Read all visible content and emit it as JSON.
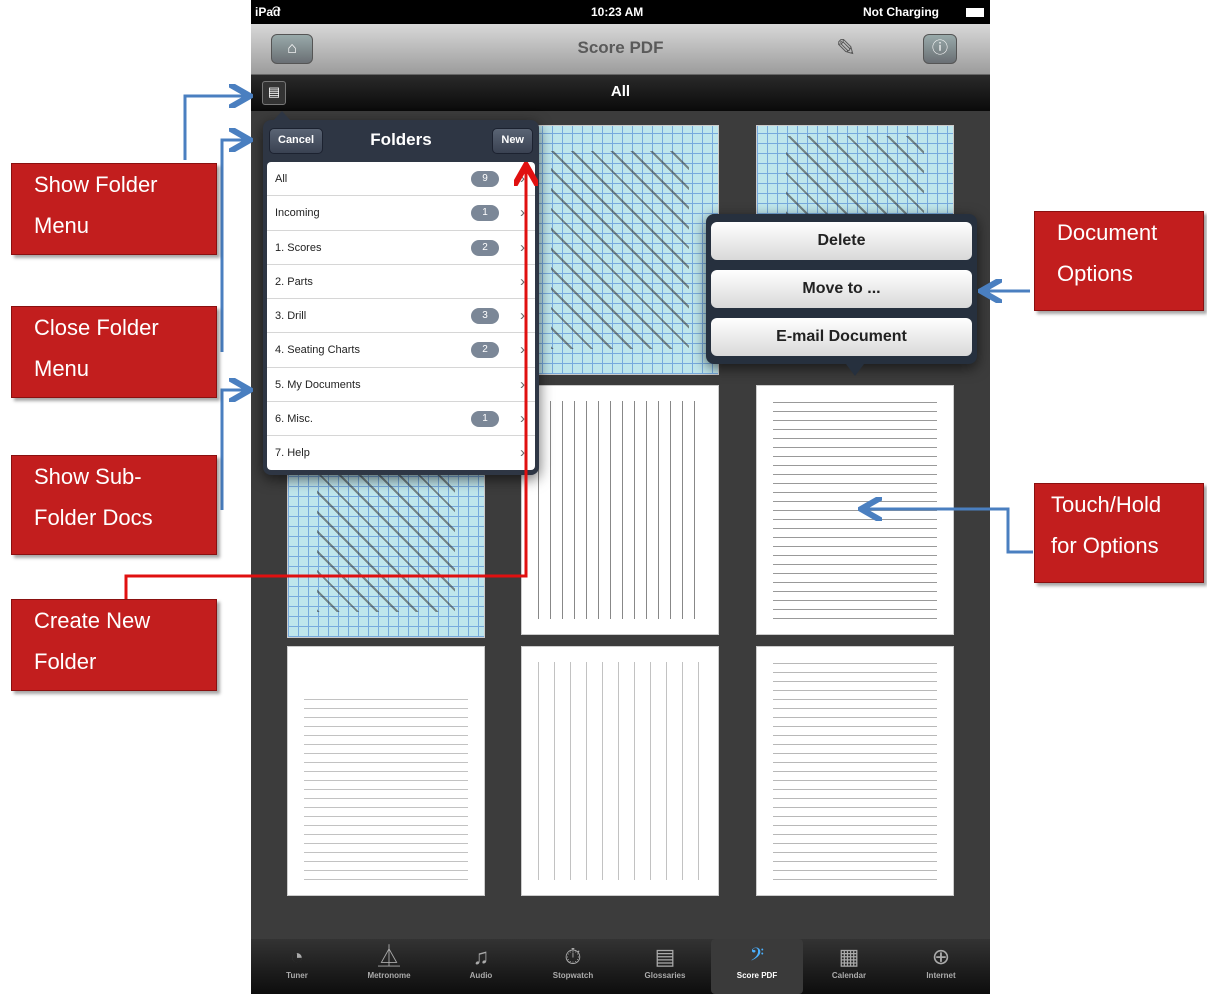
{
  "status": {
    "carrier": "iPad",
    "time": "10:23 AM",
    "battery": "Not Charging"
  },
  "nav": {
    "title": "Score PDF",
    "home_icon": "home-icon",
    "edit_icon": "pencil-icon",
    "info_icon": "info-icon"
  },
  "filter": {
    "title": "All",
    "folder_icon": "folder-icon"
  },
  "folders": {
    "title": "Folders",
    "cancel": "Cancel",
    "new": "New",
    "items": [
      {
        "label": "All",
        "count": "9"
      },
      {
        "label": "Incoming",
        "count": "1"
      },
      {
        "label": "1. Scores",
        "count": "2"
      },
      {
        "label": "2. Parts",
        "count": ""
      },
      {
        "label": "3. Drill",
        "count": "3"
      },
      {
        "label": "4. Seating Charts",
        "count": "2"
      },
      {
        "label": "5. My Documents",
        "count": ""
      },
      {
        "label": "6. Misc.",
        "count": "1"
      },
      {
        "label": "7. Help",
        "count": ""
      }
    ]
  },
  "doc_options": {
    "delete": "Delete",
    "move": "Move to ...",
    "email": "E-mail Document"
  },
  "tabs": [
    {
      "label": "Tuner",
      "icon": "tuner-icon"
    },
    {
      "label": "Metronome",
      "icon": "metronome-icon"
    },
    {
      "label": "Audio",
      "icon": "music-note-icon"
    },
    {
      "label": "Stopwatch",
      "icon": "stopwatch-icon"
    },
    {
      "label": "Glossaries",
      "icon": "glossary-icon"
    },
    {
      "label": "Score PDF",
      "icon": "bass-clef-icon"
    },
    {
      "label": "Calendar",
      "icon": "calendar-icon"
    },
    {
      "label": "Internet",
      "icon": "globe-icon"
    }
  ],
  "callouts": {
    "show_folder_1": "Show Folder",
    "show_folder_2": "Menu",
    "close_folder_1": "Close Folder",
    "close_folder_2": "Menu",
    "show_sub_1": "Show Sub-",
    "show_sub_2": "Folder Docs",
    "create_1": "Create New",
    "create_2": "Folder",
    "doc_opts_1": "Document",
    "doc_opts_2": "Options",
    "touch_1": "Touch/Hold",
    "touch_2": "for Options"
  },
  "colors": {
    "callout": "#c21e1e",
    "arrow_blue": "#4a7fc0",
    "arrow_red": "#e01010"
  }
}
